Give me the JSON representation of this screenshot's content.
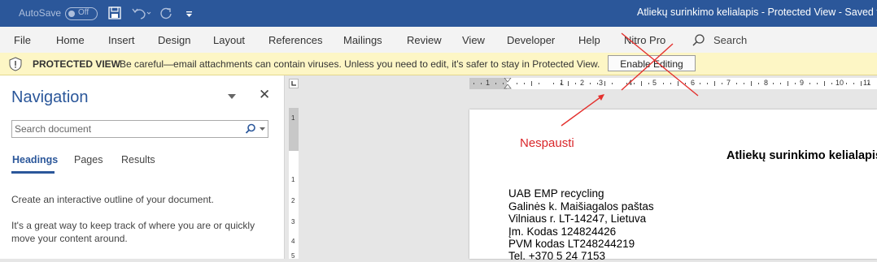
{
  "titlebar": {
    "autosave_label": "AutoSave",
    "autosave_state": "Off",
    "title": "Atliekų surinkimo kelialapis  -  Protected View  -  Saved t"
  },
  "menu": {
    "items": [
      "File",
      "Home",
      "Insert",
      "Design",
      "Layout",
      "References",
      "Mailings",
      "Review",
      "View",
      "Developer",
      "Help",
      "Nitro Pro"
    ],
    "search_label": "Search"
  },
  "protected_view": {
    "title": "PROTECTED VIEW",
    "message": "Be careful—email attachments can contain viruses. Unless you need to edit, it's safer to stay in Protected View.",
    "button": "Enable Editing"
  },
  "navigation": {
    "title": "Navigation",
    "search_placeholder": "Search document",
    "tabs": [
      "Headings",
      "Pages",
      "Results"
    ],
    "active_tab": "Headings",
    "text1": "Create an interactive outline of your document.",
    "text2": "It's a great way to keep track of where you are or quickly move your content around."
  },
  "ruler": {
    "h_numbers": [
      "1",
      "1",
      "2",
      "3",
      "4",
      "5",
      "6",
      "7",
      "8",
      "9",
      "10",
      "11"
    ],
    "v_numbers": [
      "1",
      "1",
      "2",
      "3",
      "4",
      "5"
    ]
  },
  "document": {
    "title": "Atliekų surinkimo kelialapis",
    "address": [
      "UAB EMP recycling",
      "Galinės k. Maišiagalos paštas",
      "Vilniaus r. LT-14247, Lietuva",
      "Įm. Kodas 124824426",
      "PVM kodas LT248244219",
      "Tel. +370 5 24 7153"
    ]
  },
  "annotation": {
    "label": "Nespausti",
    "color": "#d9262a"
  },
  "colors": {
    "titlebar": "#2b579a",
    "accent": "#2b579a",
    "protected_bar": "#fdf6c5"
  }
}
